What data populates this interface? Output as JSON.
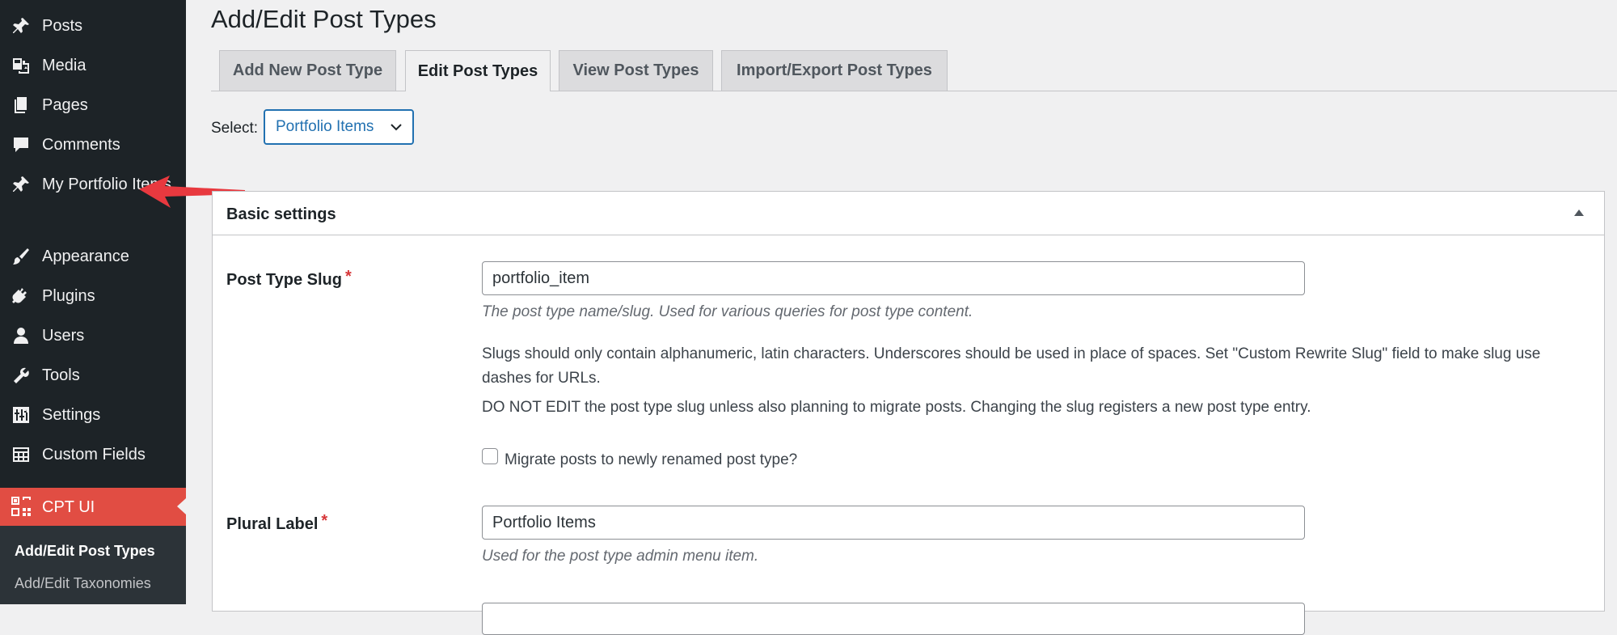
{
  "sidebar": {
    "items": [
      {
        "label": "Posts",
        "icon": "pin-icon"
      },
      {
        "label": "Media",
        "icon": "media-icon"
      },
      {
        "label": "Pages",
        "icon": "pages-icon"
      },
      {
        "label": "Comments",
        "icon": "comment-icon"
      },
      {
        "label": "My Portfolio Items",
        "icon": "pin-icon"
      },
      {
        "label": "Appearance",
        "icon": "brush-icon"
      },
      {
        "label": "Plugins",
        "icon": "plug-icon"
      },
      {
        "label": "Users",
        "icon": "user-icon"
      },
      {
        "label": "Tools",
        "icon": "wrench-icon"
      },
      {
        "label": "Settings",
        "icon": "settings-sliders-icon"
      },
      {
        "label": "Custom Fields",
        "icon": "table-icon"
      }
    ],
    "active": {
      "label": "CPT UI",
      "icon": "cptui-icon",
      "color": "#e14d43"
    },
    "submenu": [
      {
        "label": "Add/Edit Post Types",
        "current": true
      },
      {
        "label": "Add/Edit Taxonomies",
        "current": false
      }
    ]
  },
  "annotation": {
    "arrow_color": "#e8393f"
  },
  "page": {
    "title": "Add/Edit Post Types"
  },
  "tabs": [
    {
      "label": "Add New Post Type",
      "active": false
    },
    {
      "label": "Edit Post Types",
      "active": true
    },
    {
      "label": "View Post Types",
      "active": false
    },
    {
      "label": "Import/Export Post Types",
      "active": false
    }
  ],
  "select": {
    "label": "Select:",
    "value": "Portfolio Items"
  },
  "panel": {
    "title": "Basic settings",
    "slug": {
      "label": "Post Type Slug",
      "required": "*",
      "value": "portfolio_item",
      "description": "The post type name/slug. Used for various queries for post type content.",
      "note1": "Slugs should only contain alphanumeric, latin characters. Underscores should be used in place of spaces. Set \"Custom Rewrite Slug\" field to make slug use dashes for URLs.",
      "note2": "DO NOT EDIT the post type slug unless also planning to migrate posts. Changing the slug registers a new post type entry.",
      "migrate_label": "Migrate posts to newly renamed post type?"
    },
    "plural": {
      "label": "Plural Label",
      "required": "*",
      "value": "Portfolio Items",
      "description": "Used for the post type admin menu item."
    }
  },
  "colors": {
    "accent": "#2271b1",
    "sidebar": "#1d2327",
    "required": "#d63638"
  }
}
